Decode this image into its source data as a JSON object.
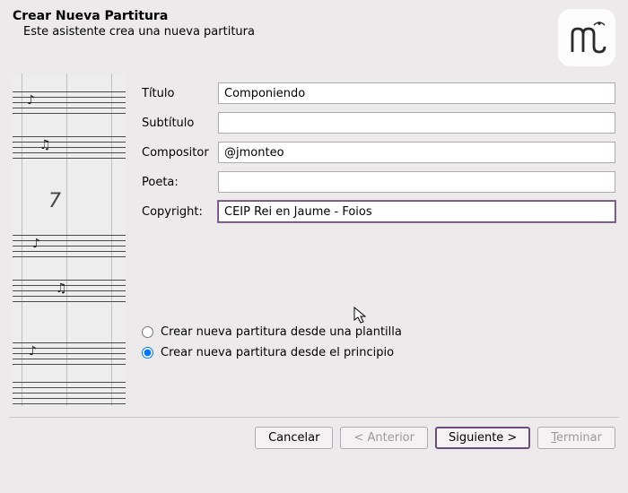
{
  "header": {
    "title": "Crear Nueva Partitura",
    "subtitle": "Este asistente crea una nueva partitura"
  },
  "form": {
    "title_label": "Título",
    "title_value": "Componiendo",
    "subtitle_label": "Subtítulo",
    "subtitle_value": "",
    "composer_label": "Compositor",
    "composer_value": "@jmonteo",
    "poet_label": "Poeta:",
    "poet_value": "",
    "copyright_label": "Copyright:",
    "copyright_value": "CEIP Rei en Jaume - Foios"
  },
  "options": {
    "template_label": "Crear nueva partitura desde una plantilla",
    "scratch_label": "Crear nueva partitura desde el principio",
    "selected": "scratch"
  },
  "buttons": {
    "cancel": "Cancelar",
    "back": "< Anterior",
    "next": "Siguiente >",
    "finish": "Terminar"
  }
}
